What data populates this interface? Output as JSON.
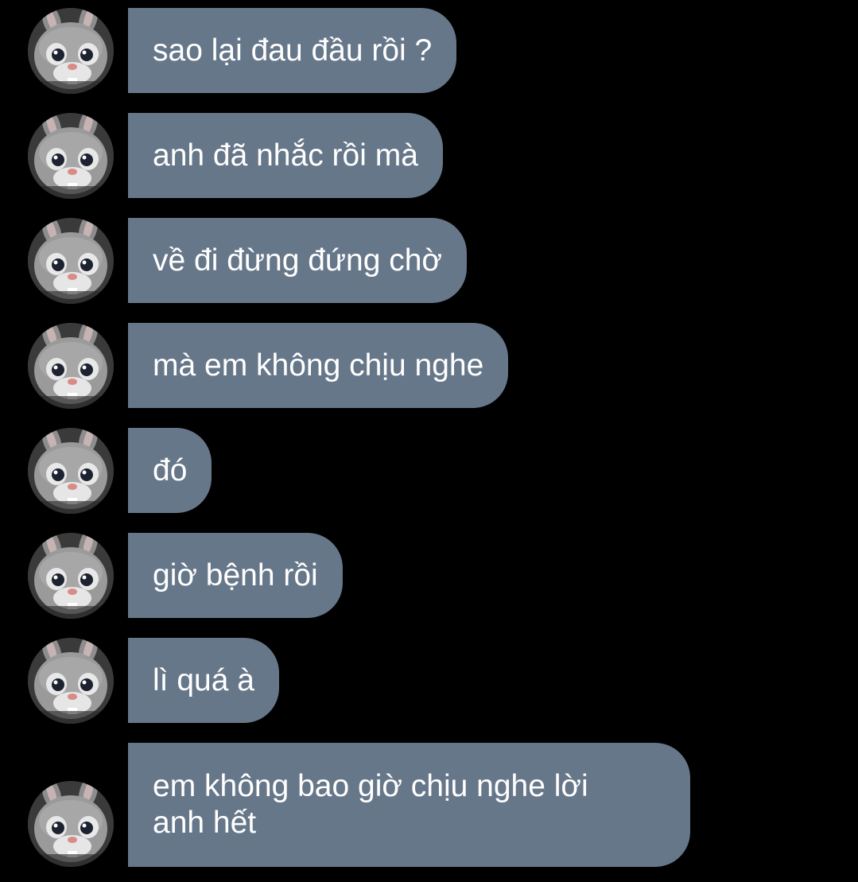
{
  "colors": {
    "background": "#000000",
    "bubble": "#67778a",
    "text": "#ffffff"
  },
  "messages": [
    {
      "text": "sao lại đau đầu rồi ?",
      "avatar_icon": "bunny-avatar-icon"
    },
    {
      "text": "anh đã nhắc rồi mà",
      "avatar_icon": "bunny-avatar-icon"
    },
    {
      "text": "về đi đừng đứng chờ",
      "avatar_icon": "bunny-avatar-icon"
    },
    {
      "text": "mà em không chịu nghe",
      "avatar_icon": "bunny-avatar-icon"
    },
    {
      "text": "đó",
      "avatar_icon": "bunny-avatar-icon"
    },
    {
      "text": "giờ bệnh rồi",
      "avatar_icon": "bunny-avatar-icon"
    },
    {
      "text": "lì quá à",
      "avatar_icon": "bunny-avatar-icon"
    },
    {
      "text": "em không bao giờ chịu nghe lời anh hết",
      "avatar_icon": "bunny-avatar-icon"
    }
  ]
}
